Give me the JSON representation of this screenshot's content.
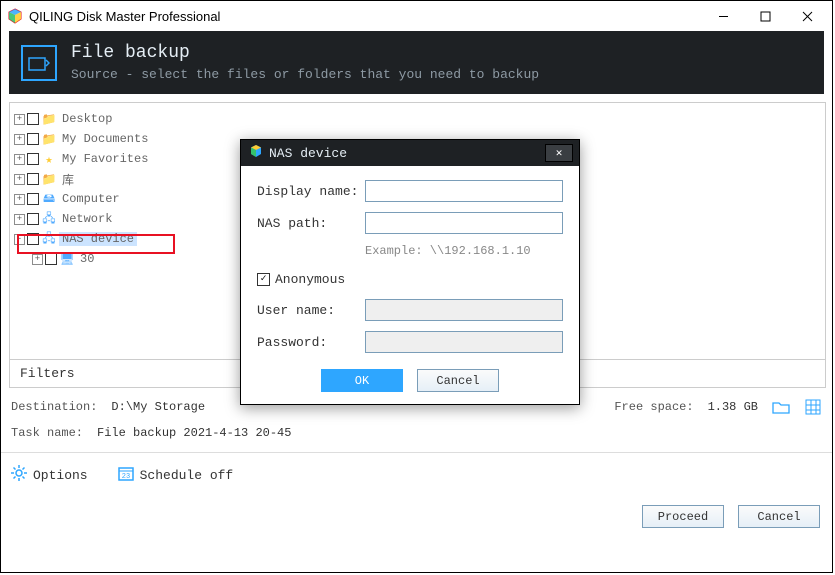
{
  "window": {
    "title": "QILING Disk Master Professional"
  },
  "header": {
    "title": "File backup",
    "subtitle": "Source - select the files or folders that you need to backup"
  },
  "tree": {
    "items": [
      {
        "label": "Desktop",
        "icon": "folder-blue",
        "exp": "+"
      },
      {
        "label": "My Documents",
        "icon": "folder-blue",
        "exp": "+"
      },
      {
        "label": "My Favorites",
        "icon": "star",
        "exp": "+"
      },
      {
        "label": "库",
        "icon": "folder-gold",
        "exp": "+"
      },
      {
        "label": "Computer",
        "icon": "drive",
        "exp": "+"
      },
      {
        "label": "Network",
        "icon": "network",
        "exp": "+"
      },
      {
        "label": "NAS device",
        "icon": "network",
        "exp": "-"
      },
      {
        "label": "30",
        "icon": "monitor",
        "exp": "+",
        "indent": 2
      }
    ]
  },
  "filters_label": "Filters",
  "destination": {
    "label": "Destination:",
    "value": "D:\\My Storage"
  },
  "freespace": {
    "label": "Free space:",
    "value": "1.38 GB"
  },
  "task": {
    "label": "Task name:",
    "value": "File backup 2021-4-13 20-45"
  },
  "options_label": "Options",
  "schedule_label": "Schedule off",
  "buttons": {
    "proceed": "Proceed",
    "cancel": "Cancel"
  },
  "dialog": {
    "title": "NAS device",
    "display_name_label": "Display name:",
    "nas_path_label": "NAS path:",
    "example": "Example: \\\\192.168.1.10",
    "anon_label": "Anonymous",
    "anon_checked": true,
    "user_label": "User name:",
    "pass_label": "Password:",
    "ok": "OK",
    "cancel": "Cancel"
  }
}
